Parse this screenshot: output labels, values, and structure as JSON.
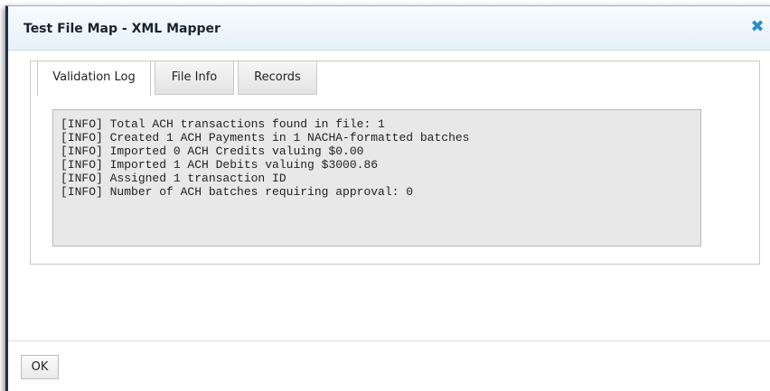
{
  "dialog": {
    "title": "Test File Map - XML Mapper",
    "close_icon": "close-icon",
    "tabs": [
      {
        "label": "Validation Log",
        "active": true
      },
      {
        "label": "File Info",
        "active": false
      },
      {
        "label": "Records",
        "active": false
      }
    ],
    "log_lines": [
      "[INFO] Total ACH transactions found in file: 1",
      "[INFO] Created 1 ACH Payments in 1 NACHA-formatted batches",
      "[INFO] Imported 0 ACH Credits valuing $0.00",
      "[INFO] Imported 1 ACH Debits valuing $3000.86",
      "[INFO] Assigned 1 transaction ID",
      "[INFO] Number of ACH batches requiring approval: 0"
    ],
    "ok_label": "OK"
  },
  "colors": {
    "accent": "#2a8fc3",
    "window_edge": "#1f2f4c",
    "log_background": "#e8e8e8"
  }
}
